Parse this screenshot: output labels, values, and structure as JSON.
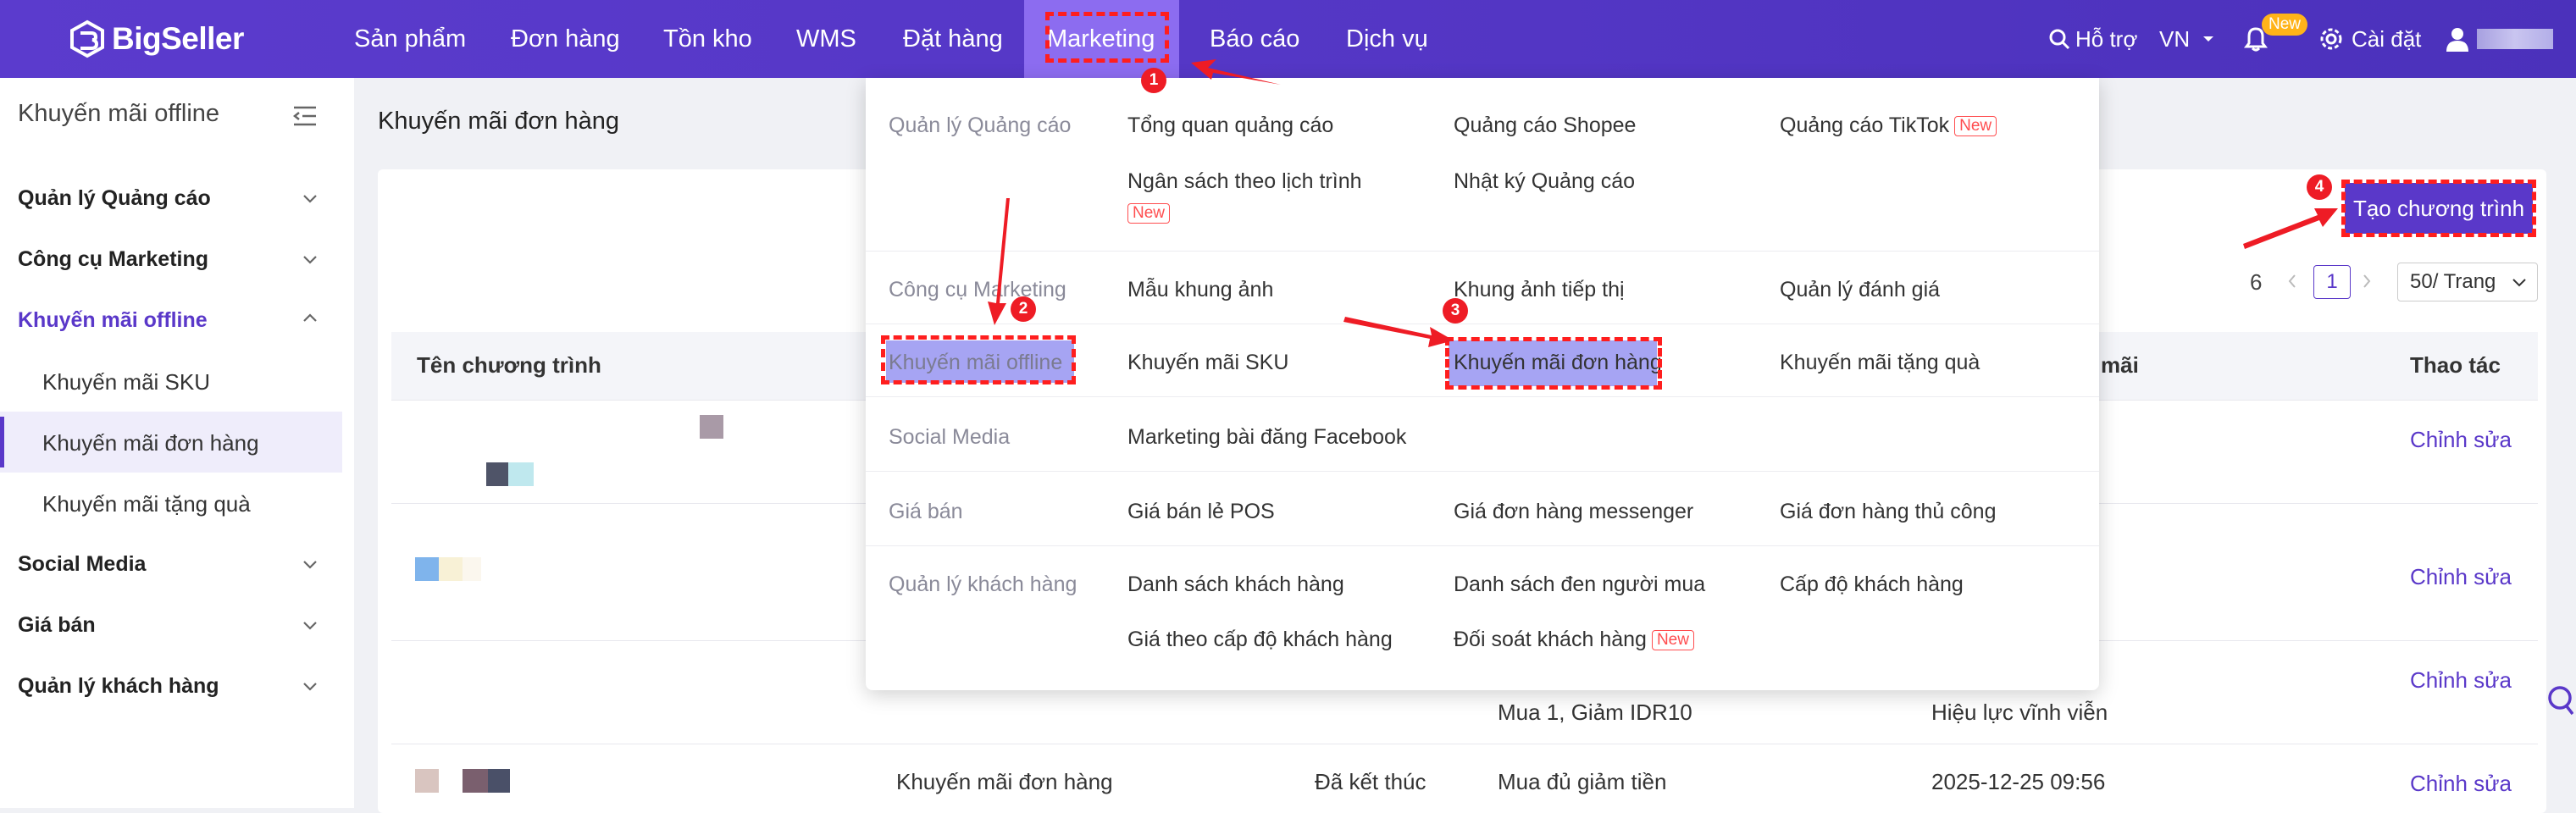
{
  "brand": {
    "name": "BigSeller"
  },
  "nav": {
    "items": [
      "Sản phẩm",
      "Đơn hàng",
      "Tồn kho",
      "WMS",
      "Đặt hàng",
      "Marketing",
      "Báo cáo",
      "Dịch vụ"
    ],
    "active": "Marketing",
    "support": "Hỗ trợ",
    "region": "VN",
    "new_badge": "New",
    "settings": "Cài đặt"
  },
  "sidebar": {
    "title": "Khuyến mãi offline",
    "groups": [
      {
        "label": "Quản lý Quảng cáo"
      },
      {
        "label": "Công cụ Marketing"
      },
      {
        "label": "Khuyến mãi offline",
        "open": true,
        "children": [
          "Khuyến mãi SKU",
          "Khuyến mãi đơn hàng",
          "Khuyến mãi tặng quà"
        ]
      },
      {
        "label": "Social Media"
      },
      {
        "label": "Giá bán"
      },
      {
        "label": "Quản lý khách hàng"
      }
    ],
    "active_child": "Khuyến mãi đơn hàng"
  },
  "page": {
    "title": "Khuyến mãi đơn hàng",
    "create_button": "Tạo chương trình",
    "pager": {
      "total": "6",
      "current": "1",
      "page_size": "50/ Trang"
    },
    "columns": [
      "Tên chương trình",
      "mãi",
      "Thao tác"
    ],
    "rows": [
      {
        "action": "Chỉnh sửa"
      },
      {
        "action": "Chỉnh sửa"
      },
      {
        "rule": "Mua 1, Giảm IDR10",
        "validity": "Hiệu lực vĩnh viễn",
        "action": "Chỉnh sửa"
      },
      {
        "type": "Khuyến mãi đơn hàng",
        "status": "Đã kết thúc",
        "rule": "Mua đủ giảm tiền",
        "date": "2025-12-25 09:56",
        "action": "Chỉnh sửa"
      }
    ]
  },
  "menu": {
    "categories": [
      {
        "label": "Quản lý Quảng cáo",
        "items": [
          "Tổng quan quảng cáo",
          "Quảng cáo Shopee",
          "Quảng cáo TikTok",
          "Ngân sách theo lịch trình",
          "Nhật ký Quảng cáo"
        ]
      },
      {
        "label": "Công cụ Marketing",
        "items": [
          "Mẫu khung ảnh",
          "Khung ảnh tiếp thị",
          "Quản lý đánh giá"
        ]
      },
      {
        "label": "Khuyến mãi offline",
        "items": [
          "Khuyến mãi SKU",
          "Khuyến mãi đơn hàng",
          "Khuyến mãi tặng quà"
        ]
      },
      {
        "label": "Social Media",
        "items": [
          "Marketing bài đăng Facebook"
        ]
      },
      {
        "label": "Giá bán",
        "items": [
          "Giá bán lẻ POS",
          "Giá đơn hàng messenger",
          "Giá đơn hàng thủ công"
        ]
      },
      {
        "label": "Quản lý khách hàng",
        "items": [
          "Danh sách khách hàng",
          "Danh sách đen người mua",
          "Cấp độ khách hàng",
          "Giá theo cấp độ khách hàng",
          "Đối soát khách hàng"
        ]
      }
    ],
    "new_tag": "New"
  },
  "annotations": {
    "steps": [
      "1",
      "2",
      "3",
      "4"
    ],
    "color": "#ff1e1e"
  },
  "colors": {
    "primary": "#5a38c9",
    "nav_active": "#8c6cf0",
    "highlight": "#a6a4f3",
    "new_badge": "#ffb319"
  }
}
